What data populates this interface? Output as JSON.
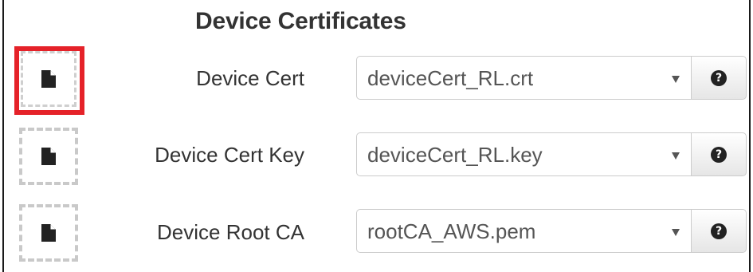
{
  "section": {
    "title": "Device Certificates"
  },
  "rows": [
    {
      "label": "Device Cert",
      "selected_file": "deviceCert_RL.crt",
      "help_glyph": "?",
      "drop_icon": "file-icon",
      "highlighted": true
    },
    {
      "label": "Device Cert Key",
      "selected_file": "deviceCert_RL.key",
      "help_glyph": "?",
      "drop_icon": "file-icon",
      "highlighted": false
    },
    {
      "label": "Device Root CA",
      "selected_file": "rootCA_AWS.pem",
      "help_glyph": "?",
      "drop_icon": "file-icon",
      "highlighted": false
    }
  ],
  "colors": {
    "highlight": "#e52229",
    "text": "#333333",
    "select_text": "#555555",
    "dashed_border": "#c9c9c9"
  }
}
